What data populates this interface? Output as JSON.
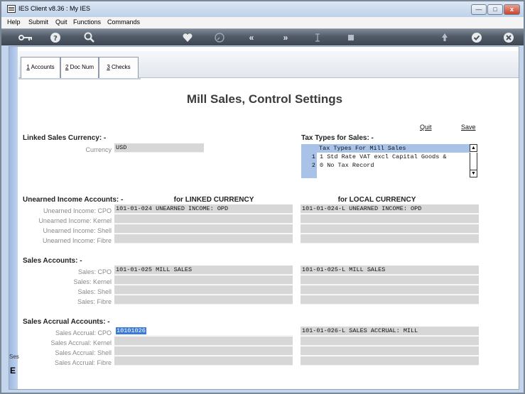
{
  "window": {
    "title": "IES Client v8.36 : My IES",
    "controls": {
      "minimize": "—",
      "maximize": "□",
      "close": "x"
    }
  },
  "menu": [
    "Help",
    "Submit",
    "Quit",
    "Functions",
    "Commands"
  ],
  "toolbar": {
    "icons": [
      "key-icon",
      "help-icon",
      "search-icon",
      "heart-icon",
      "clock-icon",
      "rewind-icon",
      "fast-forward-icon",
      "text-cursor-icon",
      "stop-icon",
      "recycle-icon",
      "check-icon",
      "close-icon"
    ]
  },
  "left_stub": {
    "line1": "Ses",
    "line2": "E"
  },
  "tabs": [
    {
      "key": "1",
      "label": " Accounts"
    },
    {
      "key": "2",
      "label": " Doc Num"
    },
    {
      "key": "3",
      "label": " Checks"
    }
  ],
  "page_title": "Mill Sales, Control Settings",
  "actions": {
    "quit": "Quit",
    "save": "Save"
  },
  "linked_currency": {
    "heading": "Linked Sales Currency: -",
    "label": "Currency",
    "value": "USD"
  },
  "tax_types": {
    "heading": "Tax Types for Sales: -",
    "list_header": "Tax Types For Mill Sales",
    "rows": [
      {
        "num": "1",
        "text": "1 Std Rate VAT excl Capital Goods &"
      },
      {
        "num": "2",
        "text": "0 No Tax Record"
      }
    ],
    "scroll_up": "▲",
    "scroll_down": "▼"
  },
  "columns": {
    "linked": "for LINKED CURRENCY",
    "local": "for LOCAL CURRENCY"
  },
  "unearned_income": {
    "heading": "Unearned Income Accounts: -",
    "rows": [
      {
        "label": "Unearned Income: CPO",
        "linked": "101-01-024 UNEARNED INCOME: OPD",
        "local": "101-01-024-L UNEARNED INCOME: OPD"
      },
      {
        "label": "Unearned Income: Kernel",
        "linked": "",
        "local": ""
      },
      {
        "label": "Unearned Income: Shell",
        "linked": "",
        "local": ""
      },
      {
        "label": "Unearned Income: Fibre",
        "linked": "",
        "local": ""
      }
    ]
  },
  "sales_accounts": {
    "heading": "Sales Accounts: -",
    "rows": [
      {
        "label": "Sales: CPO",
        "linked": "101-01-025 MILL SALES",
        "local": "101-01-025-L MILL SALES"
      },
      {
        "label": "Sales: Kernel",
        "linked": "",
        "local": ""
      },
      {
        "label": "Sales: Shell",
        "linked": "",
        "local": ""
      },
      {
        "label": "Sales: Fibre",
        "linked": "",
        "local": ""
      }
    ]
  },
  "sales_accrual": {
    "heading": "Sales Accrual Accounts: -",
    "rows": [
      {
        "label": "Sales Accrual: CPO",
        "linked": "10101026",
        "local": "101-01-026-L SALES ACCRUAL: MILL"
      },
      {
        "label": "Sales Accrual: Kernel",
        "linked": "",
        "local": ""
      },
      {
        "label": "Sales Accrual: Shell",
        "linked": "",
        "local": ""
      },
      {
        "label": "Sales Accrual: Fibre",
        "linked": "",
        "local": ""
      }
    ]
  }
}
